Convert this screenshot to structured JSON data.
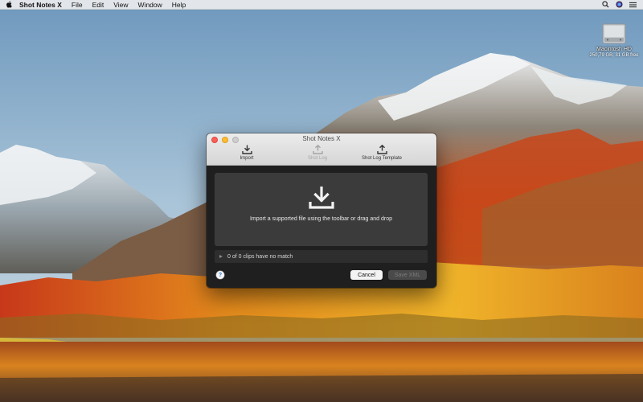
{
  "menubar": {
    "app_name": "Shot Notes X",
    "items": [
      "File",
      "Edit",
      "View",
      "Window",
      "Help"
    ]
  },
  "desktop": {
    "disk_name": "Macintosh HD",
    "disk_info": "250,79 GB, 31 GB free"
  },
  "window": {
    "title": "Shot Notes X",
    "toolbar": {
      "import": "Import",
      "shot_log": "Shot Log",
      "shot_log_template": "Shot Log Template"
    },
    "dropzone_text": "Import a supported file using the toolbar or drag and drop",
    "no_match_text": "0 of 0 clips have no match",
    "help_label": "?",
    "cancel_label": "Cancel",
    "save_label": "Save XML"
  },
  "colors": {
    "close": "#fc5f57",
    "minimize": "#fdbc2e",
    "window_bg": "#1f1f1f",
    "dropzone_bg": "#3b3b3b"
  },
  "icons": {
    "import": "download-tray-icon",
    "shot_log": "upload-tray-icon",
    "shot_log_template": "upload-tray-icon",
    "dropzone": "download-tray-icon"
  }
}
